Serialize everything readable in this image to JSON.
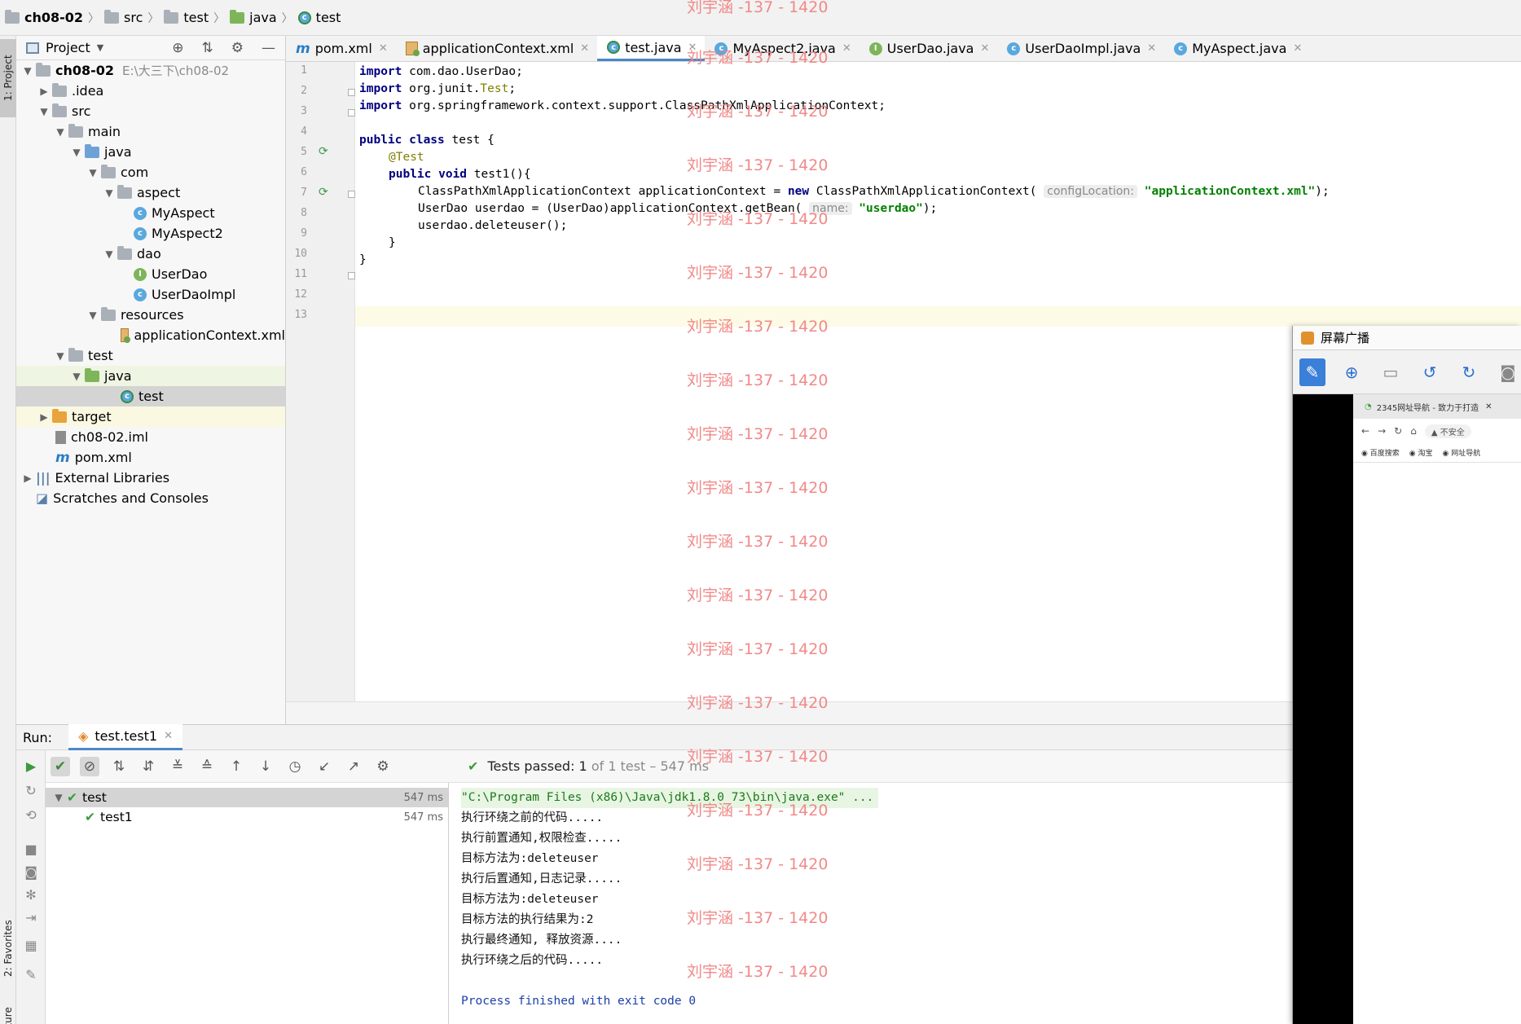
{
  "breadcrumb": {
    "items": [
      "ch08-02",
      "src",
      "test",
      "java",
      "test"
    ]
  },
  "side_tabs": {
    "project": "1: Project",
    "favorites": "2: Favorites",
    "structure": "Structure"
  },
  "project_panel": {
    "title": "Project",
    "tree": [
      {
        "label": "ch08-02",
        "path": "E:\\大三下\\ch08-02"
      },
      {
        "label": ".idea"
      },
      {
        "label": "src"
      },
      {
        "label": "main"
      },
      {
        "label": "java"
      },
      {
        "label": "com"
      },
      {
        "label": "aspect"
      },
      {
        "label": "MyAspect"
      },
      {
        "label": "MyAspect2"
      },
      {
        "label": "dao"
      },
      {
        "label": "UserDao"
      },
      {
        "label": "UserDaoImpl"
      },
      {
        "label": "resources"
      },
      {
        "label": "applicationContext.xml"
      },
      {
        "label": "test"
      },
      {
        "label": "java"
      },
      {
        "label": "test"
      },
      {
        "label": "target"
      },
      {
        "label": "ch08-02.iml"
      },
      {
        "label": "pom.xml"
      },
      {
        "label": "External Libraries"
      },
      {
        "label": "Scratches and Consoles"
      }
    ]
  },
  "editor_tabs": [
    {
      "label": "pom.xml"
    },
    {
      "label": "applicationContext.xml"
    },
    {
      "label": "test.java"
    },
    {
      "label": "MyAspect2.java"
    },
    {
      "label": "UserDao.java"
    },
    {
      "label": "UserDaoImpl.java"
    },
    {
      "label": "MyAspect.java"
    }
  ],
  "editor": {
    "line_numbers": [
      "1",
      "2",
      "3",
      "4",
      "5",
      "6",
      "7",
      "8",
      "9",
      "10",
      "11",
      "12",
      "13"
    ],
    "code": {
      "l1_kw": "import",
      "l1_rest": " com.dao.UserDao;",
      "l2_kw": "import",
      "l2_rest": " org.junit.",
      "l2_ann": "Test",
      "l2_end": ";",
      "l3_kw": "import",
      "l3_rest": " org.springframework.context.support.ClassPathXmlApplicationContext;",
      "l5_kw": "public class",
      "l5_rest": " test {",
      "l6_ann": "@Test",
      "l7_kw": "public void",
      "l7_rest": " test1(){",
      "l8_a": "ClassPathXmlApplicationContext applicationContext = ",
      "l8_kw": "new",
      "l8_b": " ClassPathXmlApplicationContext(",
      "l8_hint": "configLocation:",
      "l8_str": "\"applicationContext.xml\"",
      "l8_end": ");",
      "l9_a": "UserDao userdao = (UserDao)applicationContext.getBean(",
      "l9_hint": "name:",
      "l9_str": "\"userdao\"",
      "l9_end": ");",
      "l10": "userdao.deleteuser();",
      "l11": "}",
      "l12": "}"
    }
  },
  "run_panel": {
    "label": "Run:",
    "tab": "test.test1",
    "status_prefix": "Tests passed:",
    "status_count": "1",
    "status_rest": "of 1 test – 547 ms",
    "tests": [
      {
        "name": "test",
        "time": "547 ms"
      },
      {
        "name": "test1",
        "time": "547 ms"
      }
    ],
    "console": [
      "\"C:\\Program Files (x86)\\Java\\jdk1.8.0_73\\bin\\java.exe\" ...",
      "执行环绕之前的代码.....",
      "执行前置通知,权限检查.....",
      "目标方法为:deleteuser",
      "执行后置通知,日志记录.....",
      "目标方法为:deleteuser",
      "目标方法的执行结果为:2",
      "执行最终通知, 释放资源....",
      "执行环绕之后的代码.....",
      "",
      "Process finished with exit code 0"
    ]
  },
  "broadcast_window": {
    "title": "屏幕广播",
    "browser_tab": "2345网址导航 - 致力于打造",
    "insecure": "不安全",
    "bookmarks": [
      "百度搜索",
      "淘宝",
      "网址导航"
    ]
  },
  "watermark": "刘宇涵 -137 - 1420",
  "colors": {
    "keyword": "#000080",
    "string": "#008000",
    "annotation": "#808000",
    "watermark": "#f08080",
    "tests_passed": "#3b9a3b"
  }
}
